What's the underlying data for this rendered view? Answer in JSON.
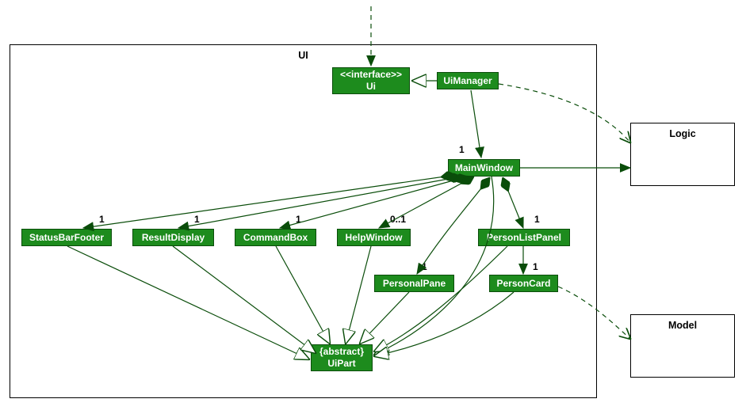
{
  "frames": {
    "ui_label": "UI",
    "logic_label": "Logic",
    "model_label": "Model"
  },
  "classes": {
    "ui_interface_stereo": "<<interface>>",
    "ui_interface_name": "Ui",
    "ui_manager": "UiManager",
    "main_window": "MainWindow",
    "status_bar_footer": "StatusBarFooter",
    "result_display": "ResultDisplay",
    "command_box": "CommandBox",
    "help_window": "HelpWindow",
    "person_list_panel": "PersonListPanel",
    "personal_pane": "PersonalPane",
    "person_card": "PersonCard",
    "ui_part_stereo": "{abstract}",
    "ui_part_name": "UiPart"
  },
  "mult": {
    "main_window": "1",
    "status_bar_footer": "1",
    "result_display": "1",
    "command_box": "1",
    "help_window": "0..1",
    "person_list_panel": "1",
    "personal_pane": "1",
    "person_card": "1"
  }
}
